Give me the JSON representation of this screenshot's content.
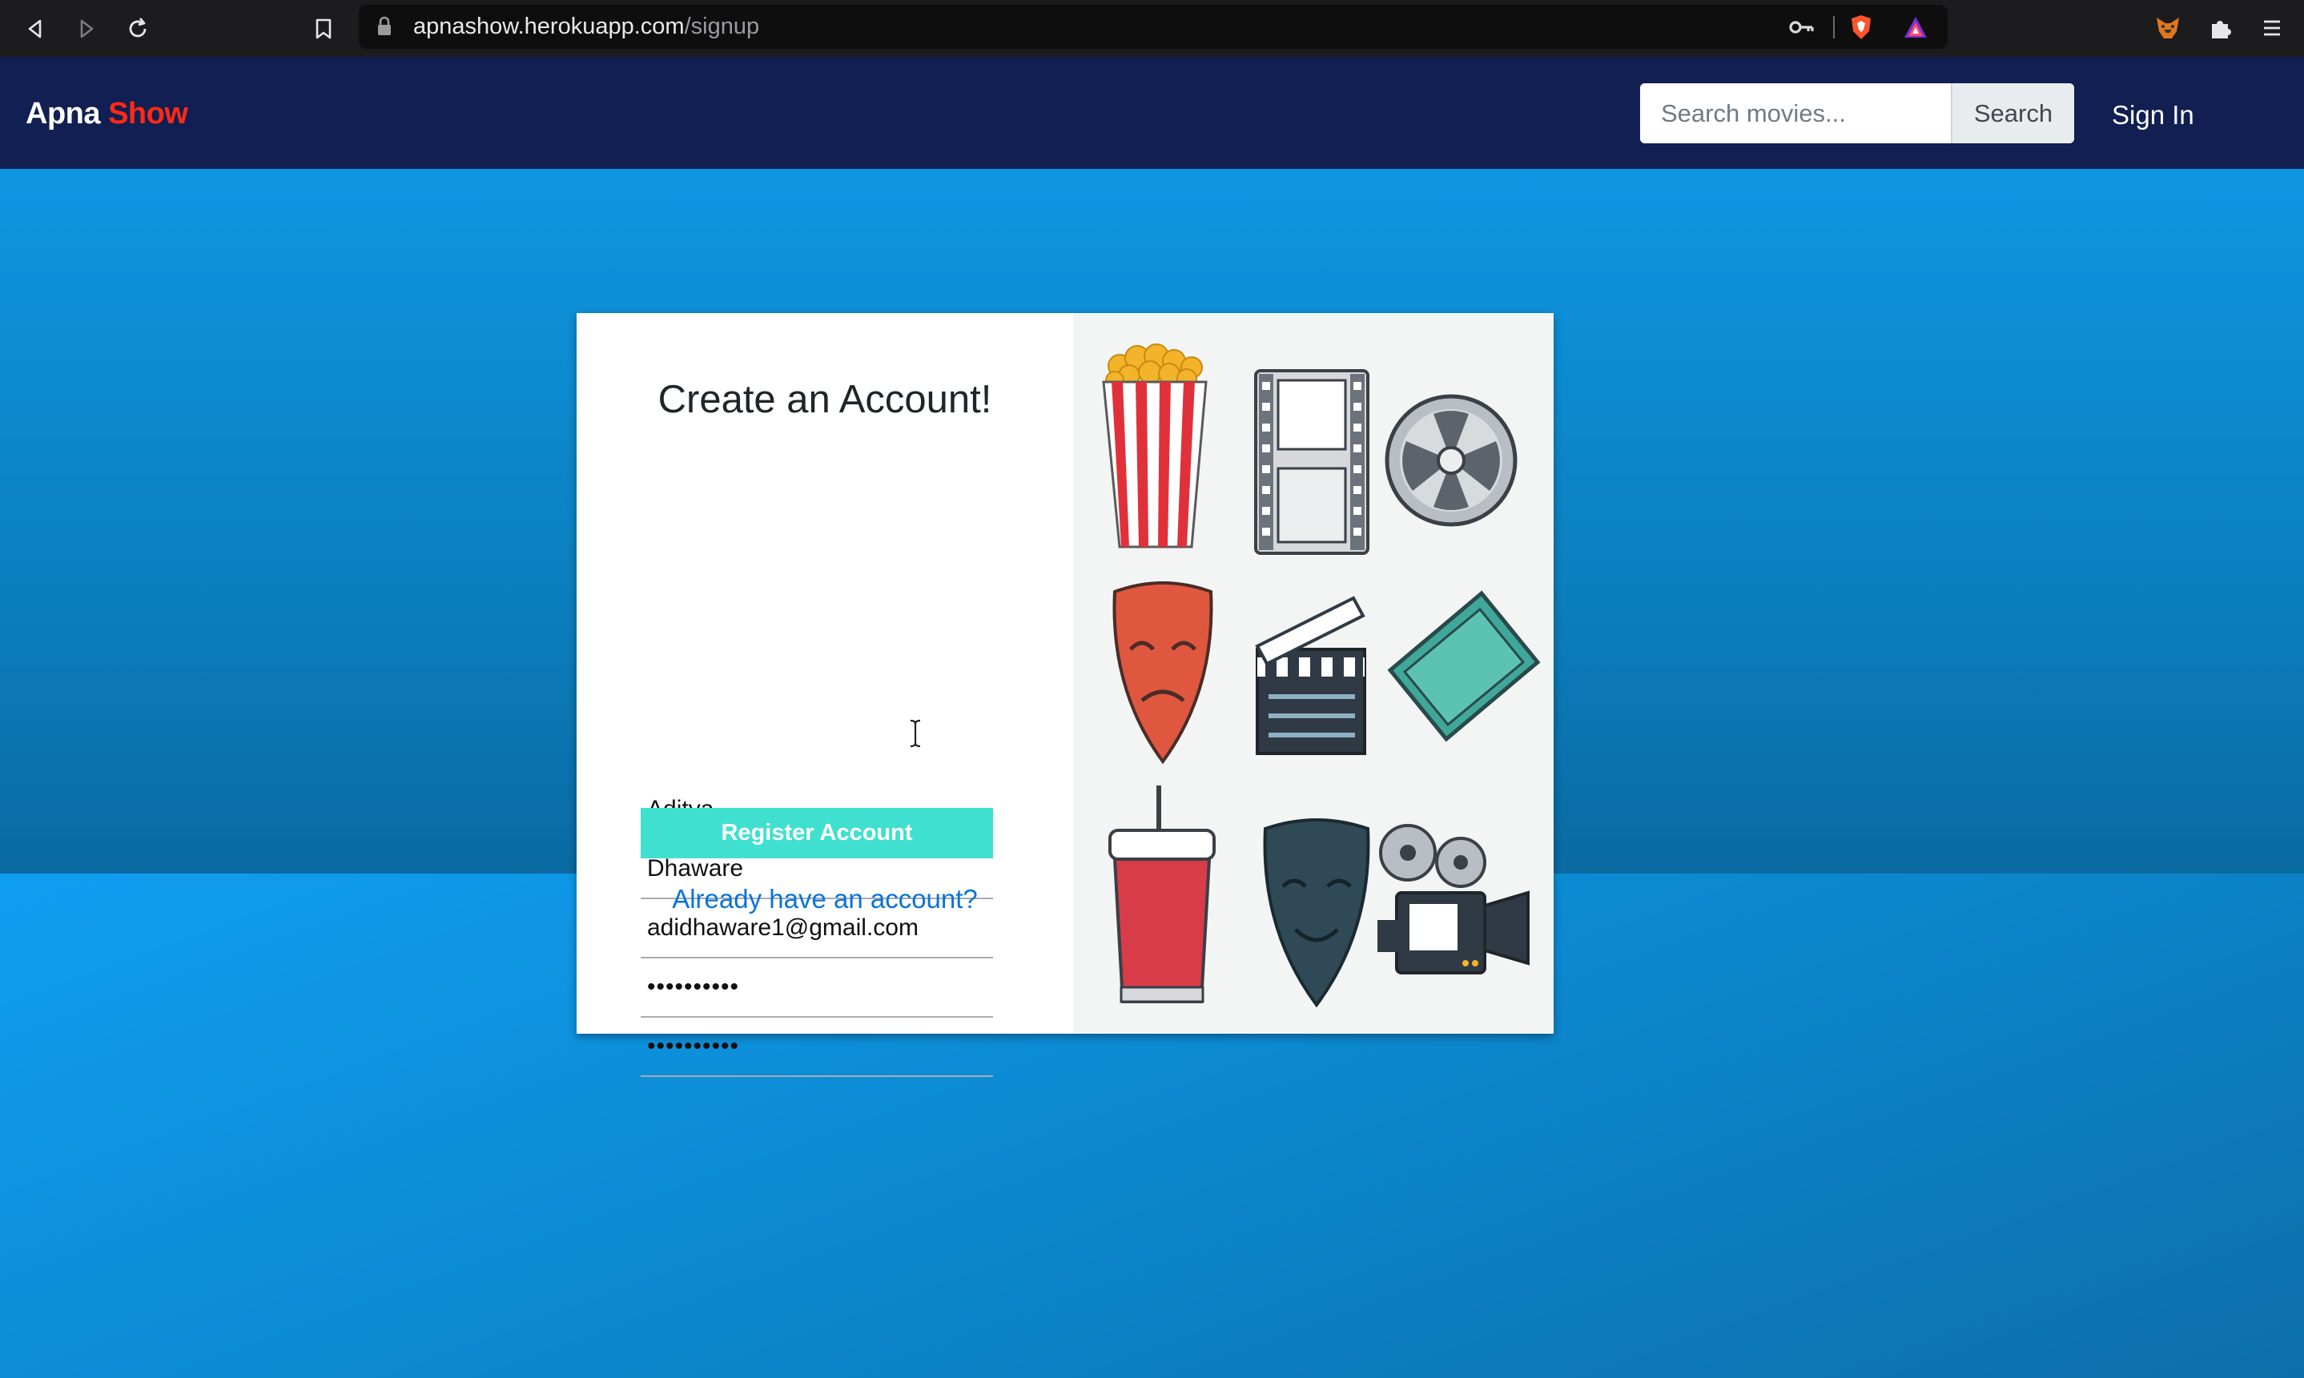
{
  "browser": {
    "url_host": "apnashow.herokuapp.com",
    "url_path": "/signup"
  },
  "header": {
    "brand_part1": "Apna",
    "brand_part2": "Show",
    "search_placeholder": "Search movies...",
    "search_button": "Search",
    "signin": "Sign In"
  },
  "form": {
    "title": "Create an Account!",
    "first_name": "Aditya",
    "last_name": "Dhaware",
    "email": "adidhaware1@gmail.com",
    "password_mask": "••••••••••",
    "confirm_mask": "••••••••••",
    "register_label": "Register Account",
    "login_link": "Already have an account?"
  },
  "illustration": {
    "icons": [
      "popcorn-icon",
      "film-strip-icon",
      "film-reel-icon",
      "tragedy-mask-icon",
      "clapperboard-icon",
      "ticket-icon",
      "soda-cup-icon",
      "comedy-mask-icon",
      "movie-projector-icon"
    ]
  },
  "colors": {
    "header_bg": "#111f52",
    "brand_accent": "#ff2a16",
    "register_button": "#40e0d0",
    "link": "#0a74d8",
    "page_bg": "#0e96e2"
  }
}
